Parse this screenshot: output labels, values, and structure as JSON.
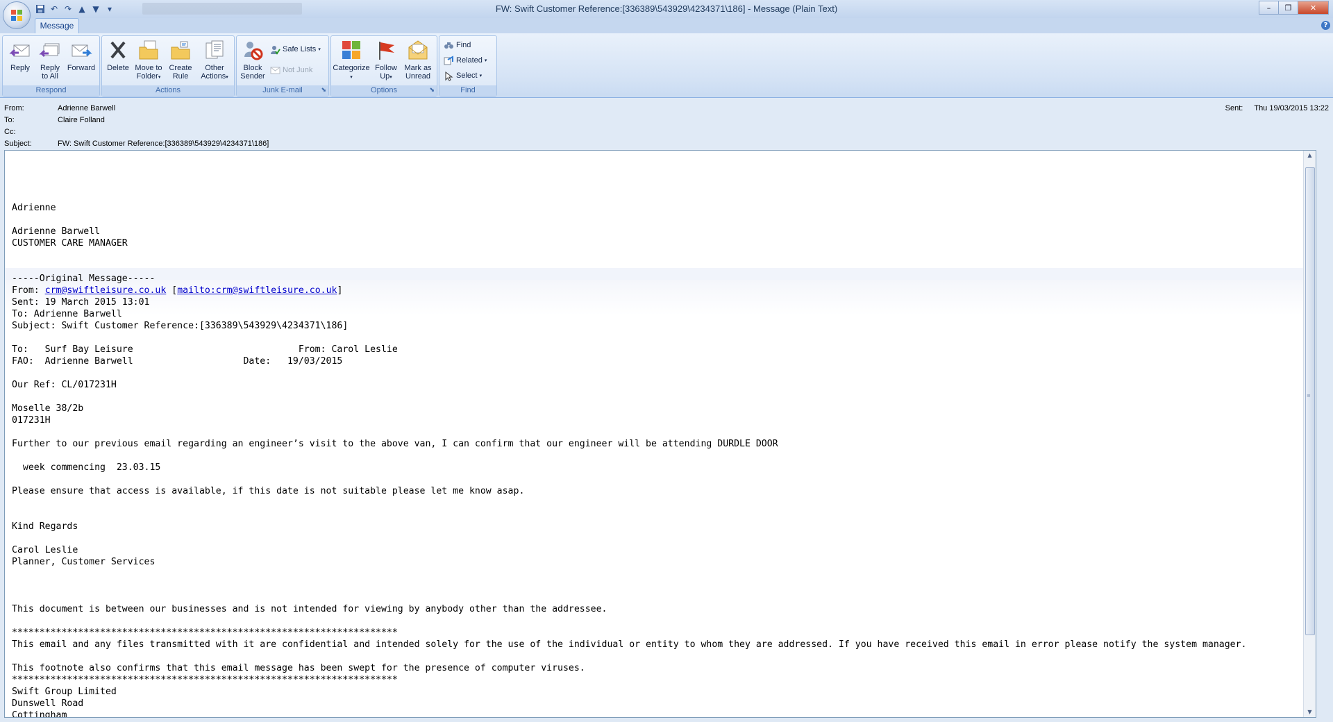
{
  "window": {
    "title": "FW: Swift Customer Reference:[336389\\543929\\4234371\\186] - Message (Plain Text)",
    "minimize": "–",
    "restore": "❐",
    "close": "✕"
  },
  "tabs": [
    {
      "label": "Message"
    }
  ],
  "ribbon": {
    "groups": {
      "respond": "Respond",
      "actions": "Actions",
      "junk": "Junk E-mail",
      "options": "Options",
      "find": "Find"
    },
    "reply": [
      "Reply",
      ""
    ],
    "reply_all": [
      "Reply",
      "to All"
    ],
    "forward": [
      "Forward",
      ""
    ],
    "delete": [
      "Delete",
      ""
    ],
    "move_to_folder": [
      "Move to",
      "Folder"
    ],
    "create_rule": [
      "Create",
      "Rule"
    ],
    "other_actions": [
      "Other",
      "Actions"
    ],
    "block_sender": [
      "Block",
      "Sender"
    ],
    "safe_lists": "Safe Lists",
    "not_junk": "Not Junk",
    "categorize": [
      "Categorize",
      ""
    ],
    "follow_up": [
      "Follow",
      "Up"
    ],
    "mark_unread": [
      "Mark as",
      "Unread"
    ],
    "find": "Find",
    "related": "Related",
    "select": "Select"
  },
  "header": {
    "from_label": "From:",
    "from": "Adrienne Barwell",
    "to_label": "To:",
    "to": "Claire Folland",
    "cc_label": "Cc:",
    "cc": "",
    "subject_label": "Subject:",
    "subject": "FW: Swift Customer Reference:[336389\\543929\\4234371\\186]",
    "sent_label": "Sent:",
    "sent": "Thu 19/03/2015 13:22"
  },
  "body": {
    "lines_top": "\n\nAdrienne\n\nAdrienne Barwell\nCUSTOMER CARE MANAGER\n\n\n-----Original Message-----\nFrom: ",
    "link1": "crm@swiftleisure.co.uk",
    "between": " [",
    "link2": "mailto:crm@swiftleisure.co.uk",
    "after": "]\nSent: 19 March 2015 13:01\nTo: Adrienne Barwell\nSubject: Swift Customer Reference:[336389\\543929\\4234371\\186]\n\nTo:   Surf Bay Leisure                              From: Carol Leslie\nFAO:  Adrienne Barwell                    Date:   19/03/2015\n\nOur Ref: CL/017231H\n\nMoselle 38/2b\n017231H\n\nFurther to our previous email regarding an engineer’s visit to the above van, I can confirm that our engineer will be attending DURDLE DOOR\n\n  week commencing  23.03.15\n\nPlease ensure that access is available, if this date is not suitable please let me know asap.\n\n\nKind Regards\n\nCarol Leslie\nPlanner, Customer Services\n\n\n\nThis document is between our businesses and is not intended for viewing by anybody other than the addressee.\n\n**********************************************************************\nThis email and any files transmitted with it are confidential and intended solely for the use of the individual or entity to whom they are addressed. If you have received this email in error please notify the system manager.\n\nThis footnote also confirms that this email message has been swept for the presence of computer viruses.\n**********************************************************************\nSwift Group Limited\nDunswell Road\nCottingham\nEast Yorkshire"
  },
  "icons": [
    "office-orb-icon",
    "save-icon",
    "undo-icon",
    "redo-icon",
    "previous-icon",
    "next-icon",
    "reply-icon",
    "reply-all-icon",
    "forward-icon",
    "delete-icon",
    "move-folder-icon",
    "create-rule-icon",
    "other-actions-icon",
    "block-sender-icon",
    "safe-lists-icon",
    "not-junk-icon",
    "categorize-icon",
    "follow-up-flag-icon",
    "mark-unread-icon",
    "find-icon",
    "related-icon",
    "select-icon"
  ],
  "colors": {
    "ribbon": "#dce8f7",
    "accent": "#15428b",
    "link": "#0000cc",
    "close": "#c8472a"
  }
}
